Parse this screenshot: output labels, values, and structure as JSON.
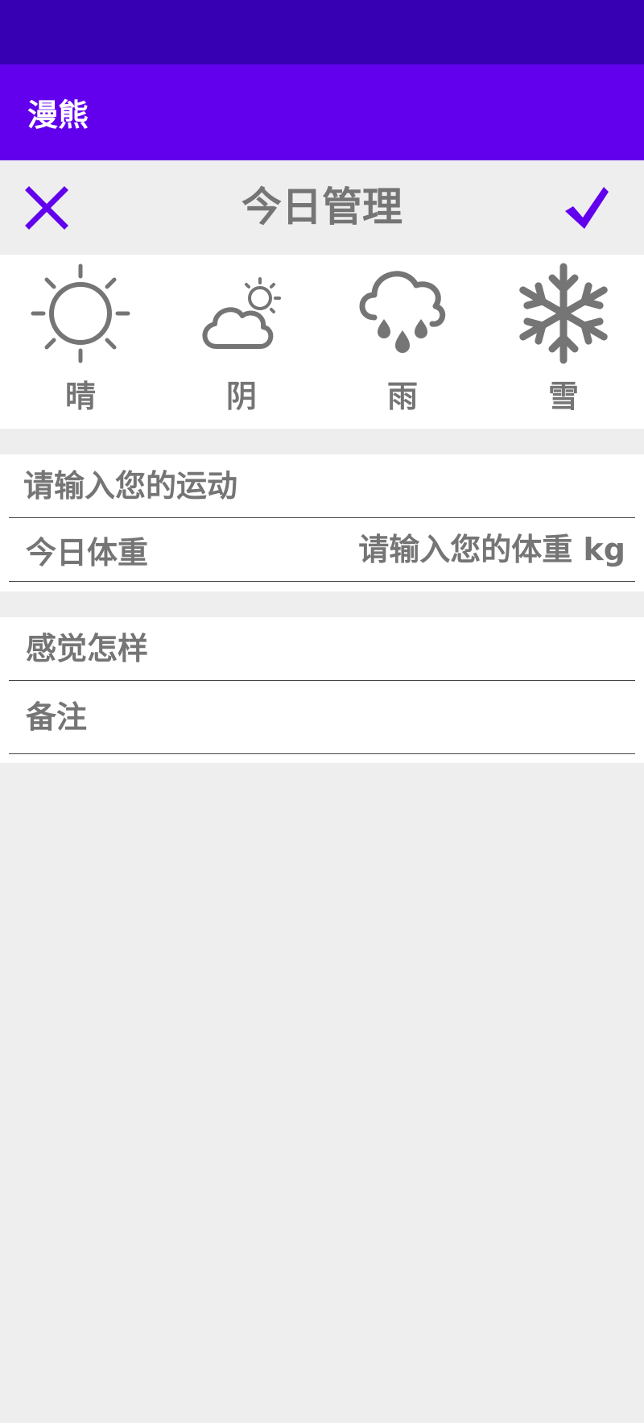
{
  "app": {
    "title": "漫熊"
  },
  "header": {
    "title": "今日管理",
    "close_icon": "close-icon",
    "confirm_icon": "checkmark-icon"
  },
  "colors": {
    "accent": "#6200ee",
    "status_bar": "#3700b3",
    "icon_gray": "#757575"
  },
  "weather": [
    {
      "label": "晴",
      "icon": "sun-icon"
    },
    {
      "label": "阴",
      "icon": "cloud-sun-icon"
    },
    {
      "label": "雨",
      "icon": "rain-icon"
    },
    {
      "label": "雪",
      "icon": "snowflake-icon"
    }
  ],
  "form": {
    "sport_placeholder": "请输入您的运动",
    "weight_label": "今日体重",
    "weight_placeholder": "请输入您的体重 kg",
    "feeling_placeholder": "感觉怎样",
    "note_placeholder": "备注"
  }
}
